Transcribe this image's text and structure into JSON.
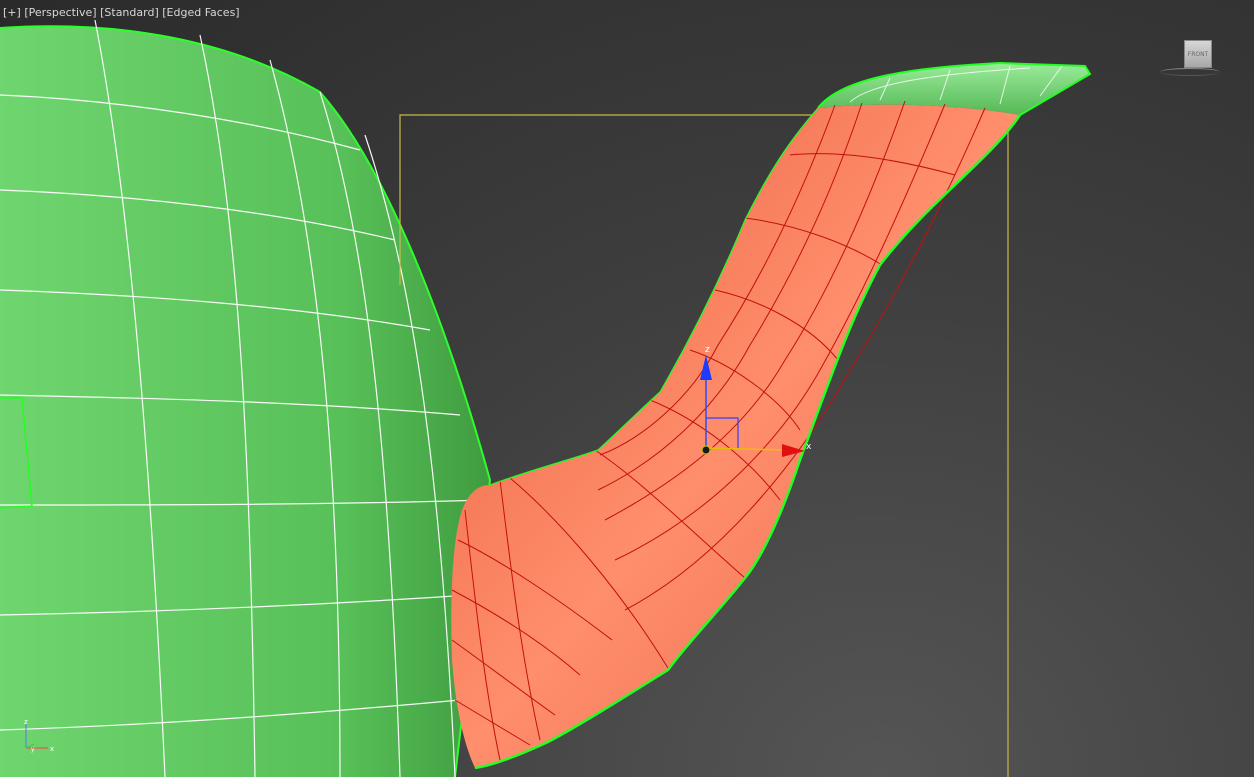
{
  "viewport": {
    "label_plus": "[+]",
    "label_view": "[Perspective]",
    "label_shading": "[Standard]",
    "label_mode": "[Edged Faces]"
  },
  "viewcube": {
    "face_label": "FRONT"
  },
  "gizmo": {
    "z_label": "z",
    "x_label": "x"
  },
  "tripod": {
    "z_label": "z",
    "y_label": "y",
    "x_label": "x"
  },
  "colors": {
    "body_green": "#5bc35b",
    "wire_white": "#ffffff",
    "spout_red": "#f07a5a",
    "wire_red": "#c4100c",
    "selection_yellow": "#c9b84a",
    "bright_green": "#22ff22"
  }
}
